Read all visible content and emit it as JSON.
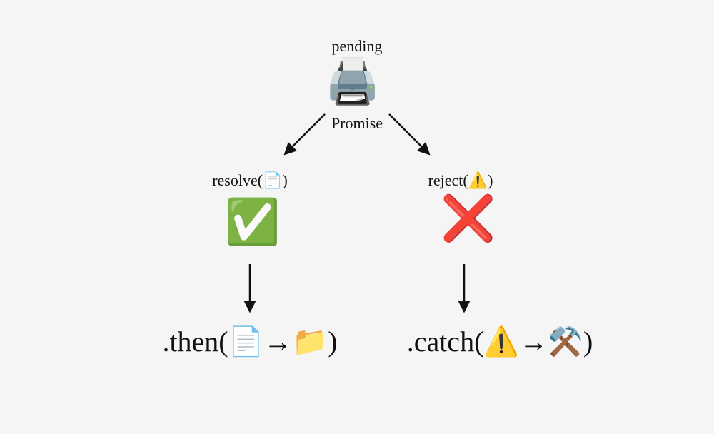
{
  "top": {
    "state": "pending",
    "icon": "🖨️",
    "type": "Promise"
  },
  "left": {
    "call": "resolve(📄)",
    "status_icon": "✅",
    "handler": ".then(📄→📁)"
  },
  "right": {
    "call": "reject(⚠️)",
    "status_icon": "❌",
    "handler": ".catch(⚠️→⚒️)"
  }
}
